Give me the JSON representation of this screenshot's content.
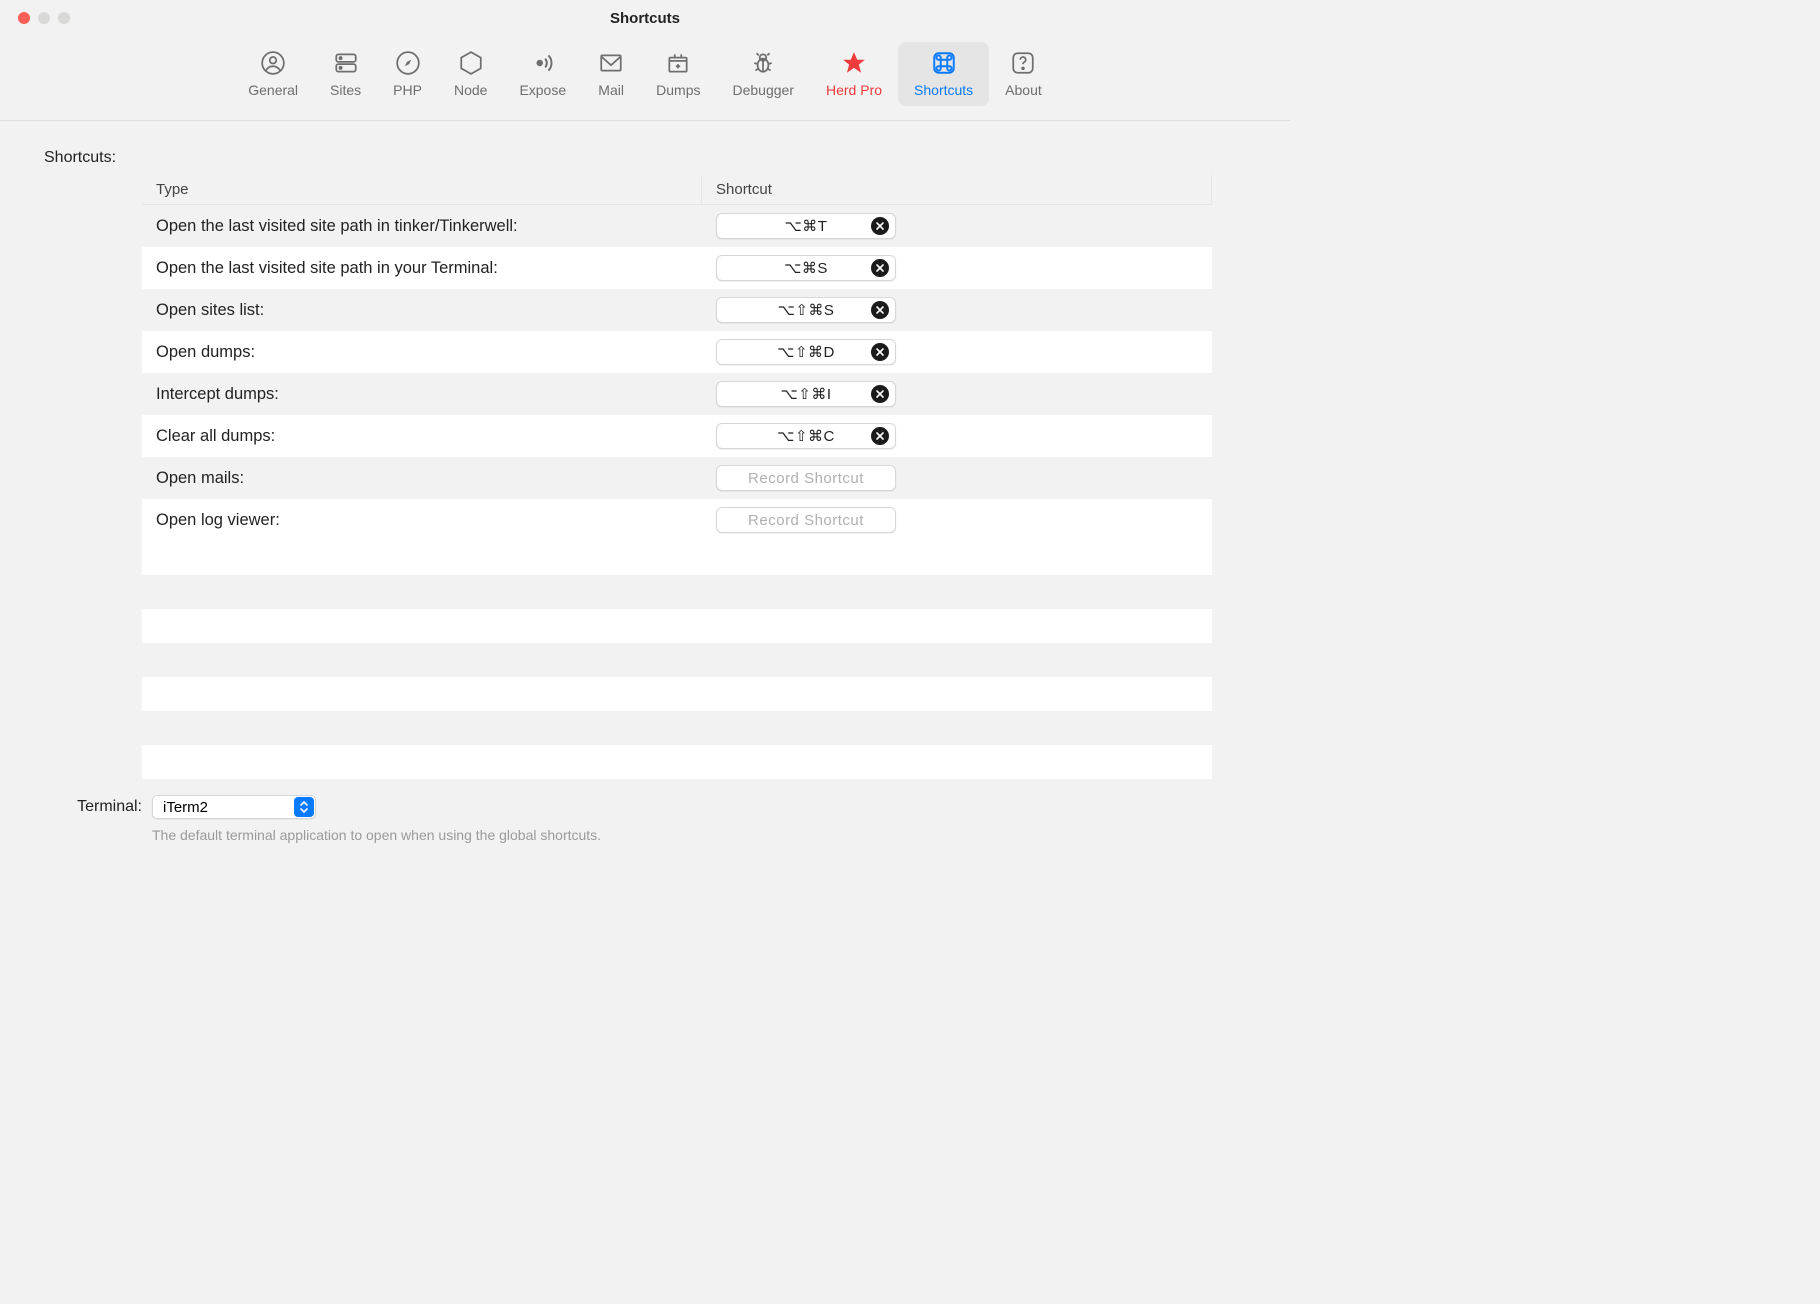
{
  "window": {
    "title": "Shortcuts"
  },
  "toolbar": {
    "items": [
      {
        "id": "general",
        "label": "General"
      },
      {
        "id": "sites",
        "label": "Sites"
      },
      {
        "id": "php",
        "label": "PHP"
      },
      {
        "id": "node",
        "label": "Node"
      },
      {
        "id": "expose",
        "label": "Expose"
      },
      {
        "id": "mail",
        "label": "Mail"
      },
      {
        "id": "dumps",
        "label": "Dumps"
      },
      {
        "id": "debugger",
        "label": "Debugger"
      },
      {
        "id": "herd-pro",
        "label": "Herd Pro"
      },
      {
        "id": "shortcuts",
        "label": "Shortcuts"
      },
      {
        "id": "about",
        "label": "About"
      }
    ],
    "active": "shortcuts"
  },
  "section_label": "Shortcuts:",
  "columns": {
    "type": "Type",
    "shortcut": "Shortcut"
  },
  "rows": [
    {
      "type": "Open the last visited site path in tinker/Tinkerwell:",
      "shortcut": "⌥⌘T",
      "hasClear": true
    },
    {
      "type": "Open the last visited site path in your Terminal:",
      "shortcut": "⌥⌘S",
      "hasClear": true
    },
    {
      "type": "Open sites list:",
      "shortcut": "⌥⇧⌘S",
      "hasClear": true
    },
    {
      "type": "Open dumps:",
      "shortcut": "⌥⇧⌘D",
      "hasClear": true
    },
    {
      "type": "Intercept dumps:",
      "shortcut": "⌥⇧⌘I",
      "hasClear": true
    },
    {
      "type": "Clear all dumps:",
      "shortcut": "⌥⇧⌘C",
      "hasClear": true
    },
    {
      "type": "Open mails:",
      "shortcut": "",
      "placeholder": "Record Shortcut",
      "hasClear": false
    },
    {
      "type": "Open log viewer:",
      "shortcut": "",
      "placeholder": "Record Shortcut",
      "hasClear": false
    }
  ],
  "terminal": {
    "label": "Terminal:",
    "value": "iTerm2",
    "hint": "The default terminal application to open when using the global shortcuts."
  }
}
